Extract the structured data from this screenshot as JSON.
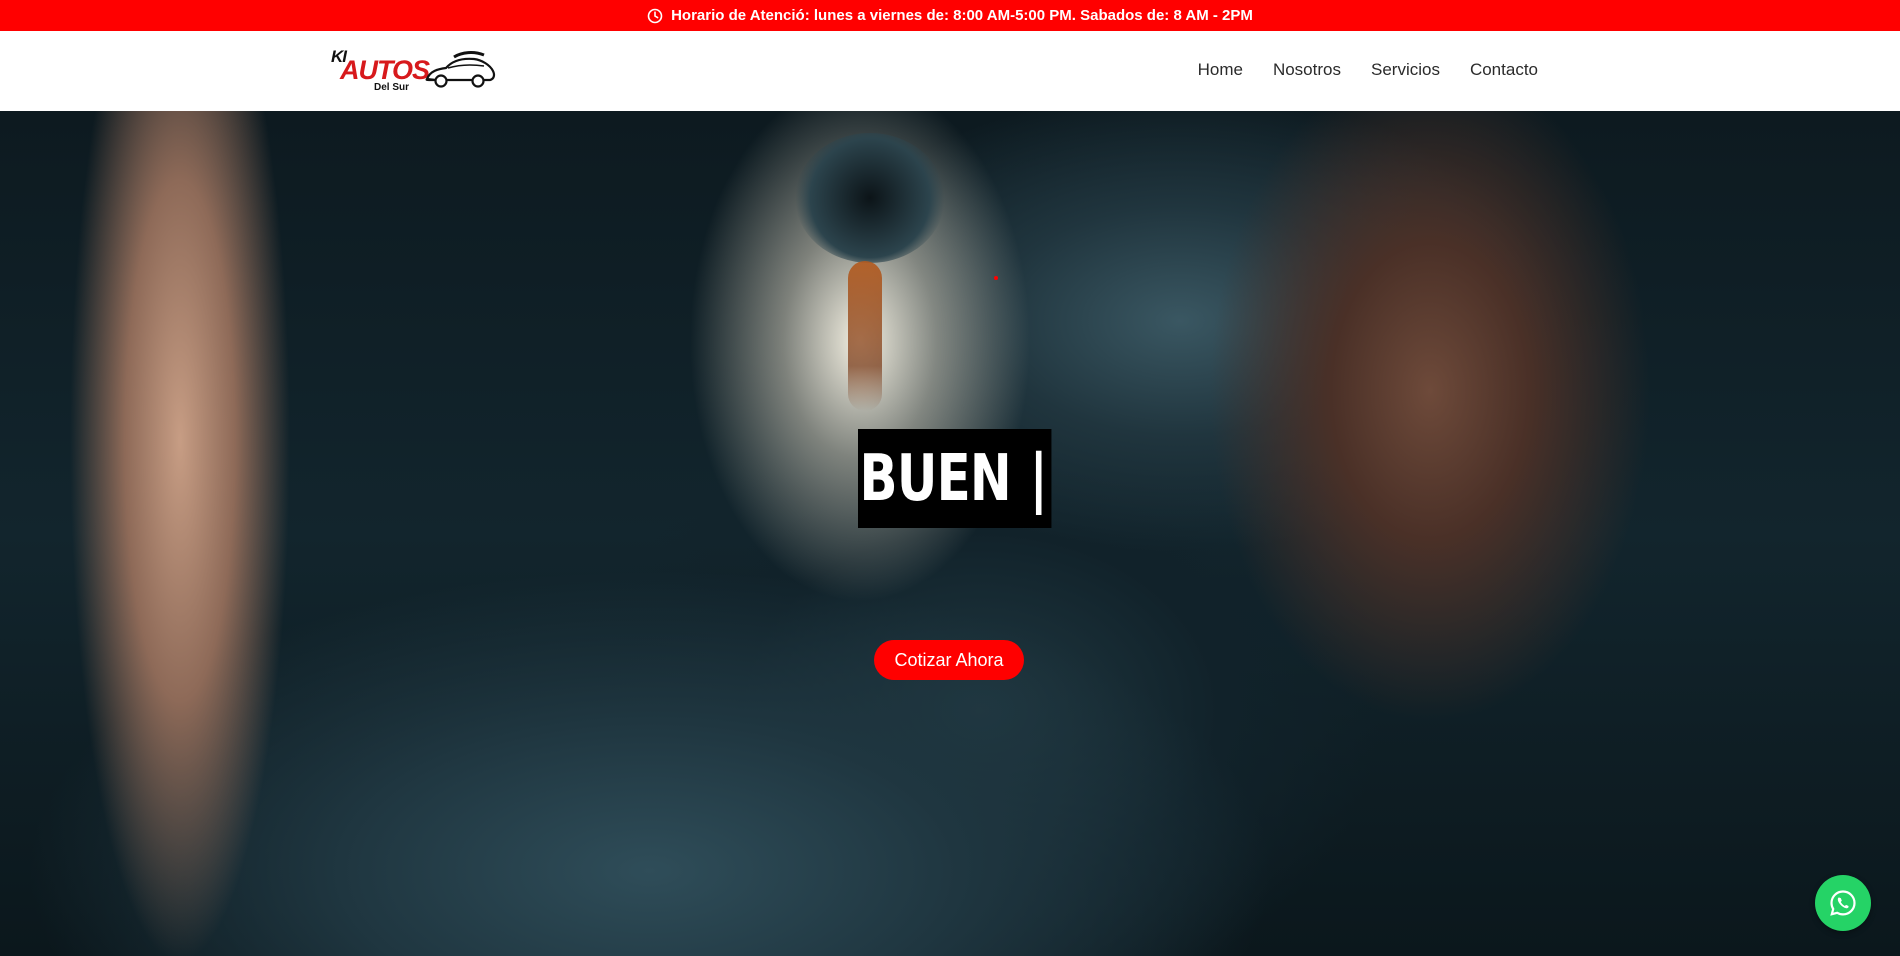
{
  "topbar": {
    "schedule_text": "Horario de Atenció: lunes a viernes de: 8:00 AM-5:00 PM. Sabados de: 8 AM - 2PM",
    "icon": "clock-icon",
    "background_color": "#ff0000"
  },
  "brand": {
    "logo_line1": "KI",
    "logo_line2": "AUTOS",
    "logo_line3": "Del Sur",
    "logo_icon": "car-icon",
    "accent_color": "#d7191c"
  },
  "nav": {
    "items": [
      {
        "label": "Home"
      },
      {
        "label": "Nosotros"
      },
      {
        "label": "Servicios"
      },
      {
        "label": "Contacto"
      }
    ]
  },
  "hero": {
    "headline": "BUEN",
    "cursor": "|",
    "cta_label": "Cotizar Ahora",
    "cta_color": "#ff0000"
  },
  "floating": {
    "whatsapp_icon": "whatsapp-icon",
    "whatsapp_color": "#25d366"
  }
}
